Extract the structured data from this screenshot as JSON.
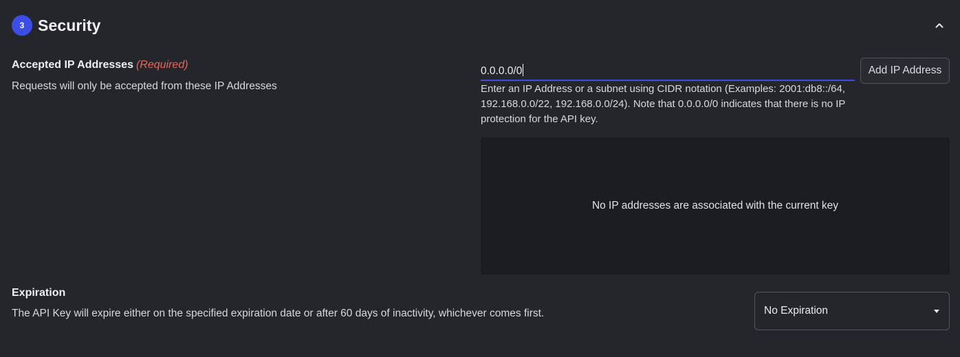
{
  "section": {
    "step_number": "3",
    "title": "Security",
    "toggle_icon": "chevron-up-icon"
  },
  "ip_addresses": {
    "label": "Accepted IP Addresses",
    "required_label": "(Required)",
    "description": "Requests will only be accepted from these IP Addresses",
    "input_value": "0.0.0.0/0",
    "add_button_label": "Add IP Address",
    "helper_text": "Enter an IP Address or a subnet using CIDR notation (Examples: 2001:db8::/64, 192.168.0.0/22, 192.168.0.0/24). Note that 0.0.0.0/0 indicates that there is no IP protection for the API key.",
    "empty_message": "No IP addresses are associated with the current key"
  },
  "expiration": {
    "label": "Expiration",
    "description": "The API Key will expire either on the specified expiration date or after 60 days of inactivity, whichever comes first.",
    "selected_value": "No Expiration"
  },
  "colors": {
    "background": "#25262b",
    "accent": "#3d4ee8",
    "required": "#e8655a",
    "empty_panel": "#1c1d21"
  }
}
